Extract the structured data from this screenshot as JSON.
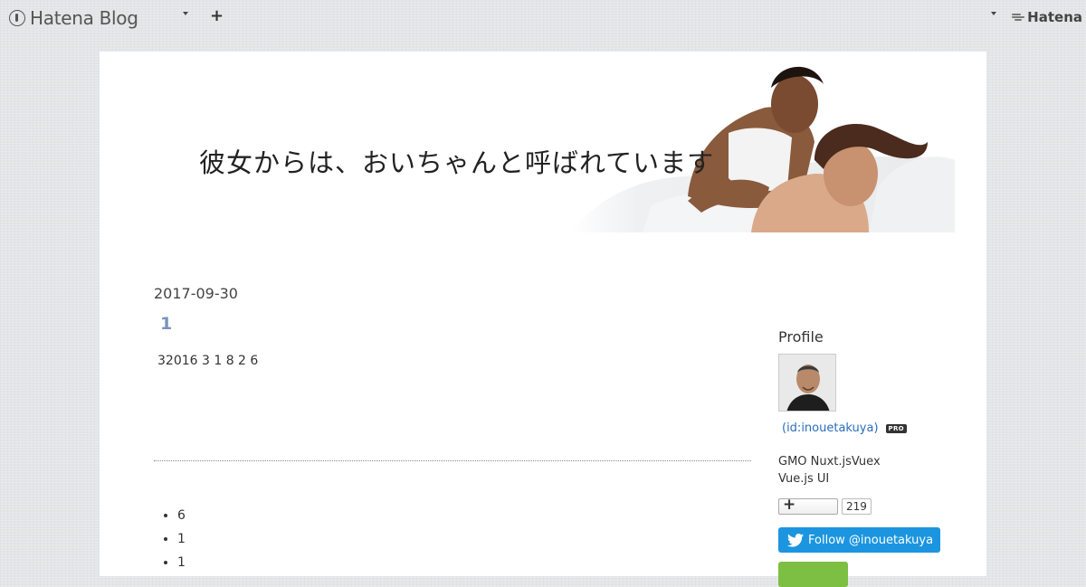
{
  "topbar": {
    "logo_text": "Hatena Blog",
    "add_label": "+",
    "right_brand": "Hatena"
  },
  "header": {
    "blog_title": "彼女からは、おいちゃんと呼ばれています"
  },
  "entry": {
    "date": "2017-09-30",
    "title": "1",
    "body": "32016 3 1 8 2 6"
  },
  "list_items": [
    "6",
    "1",
    "1"
  ],
  "sidebar": {
    "title": "Profile",
    "profile_id": "(id:inouetakuya)",
    "pro_badge": "PRO",
    "description_line1": "GMO Nuxt.jsVuex",
    "description_line2": "Vue.js  UI",
    "bookmark_count": "219",
    "follow_label": "Follow @inouetakuya"
  },
  "colors": {
    "accent_title": "#7b93b8",
    "link": "#2a6ebb",
    "twitter": "#1b95e0",
    "green": "#7cbf42"
  }
}
